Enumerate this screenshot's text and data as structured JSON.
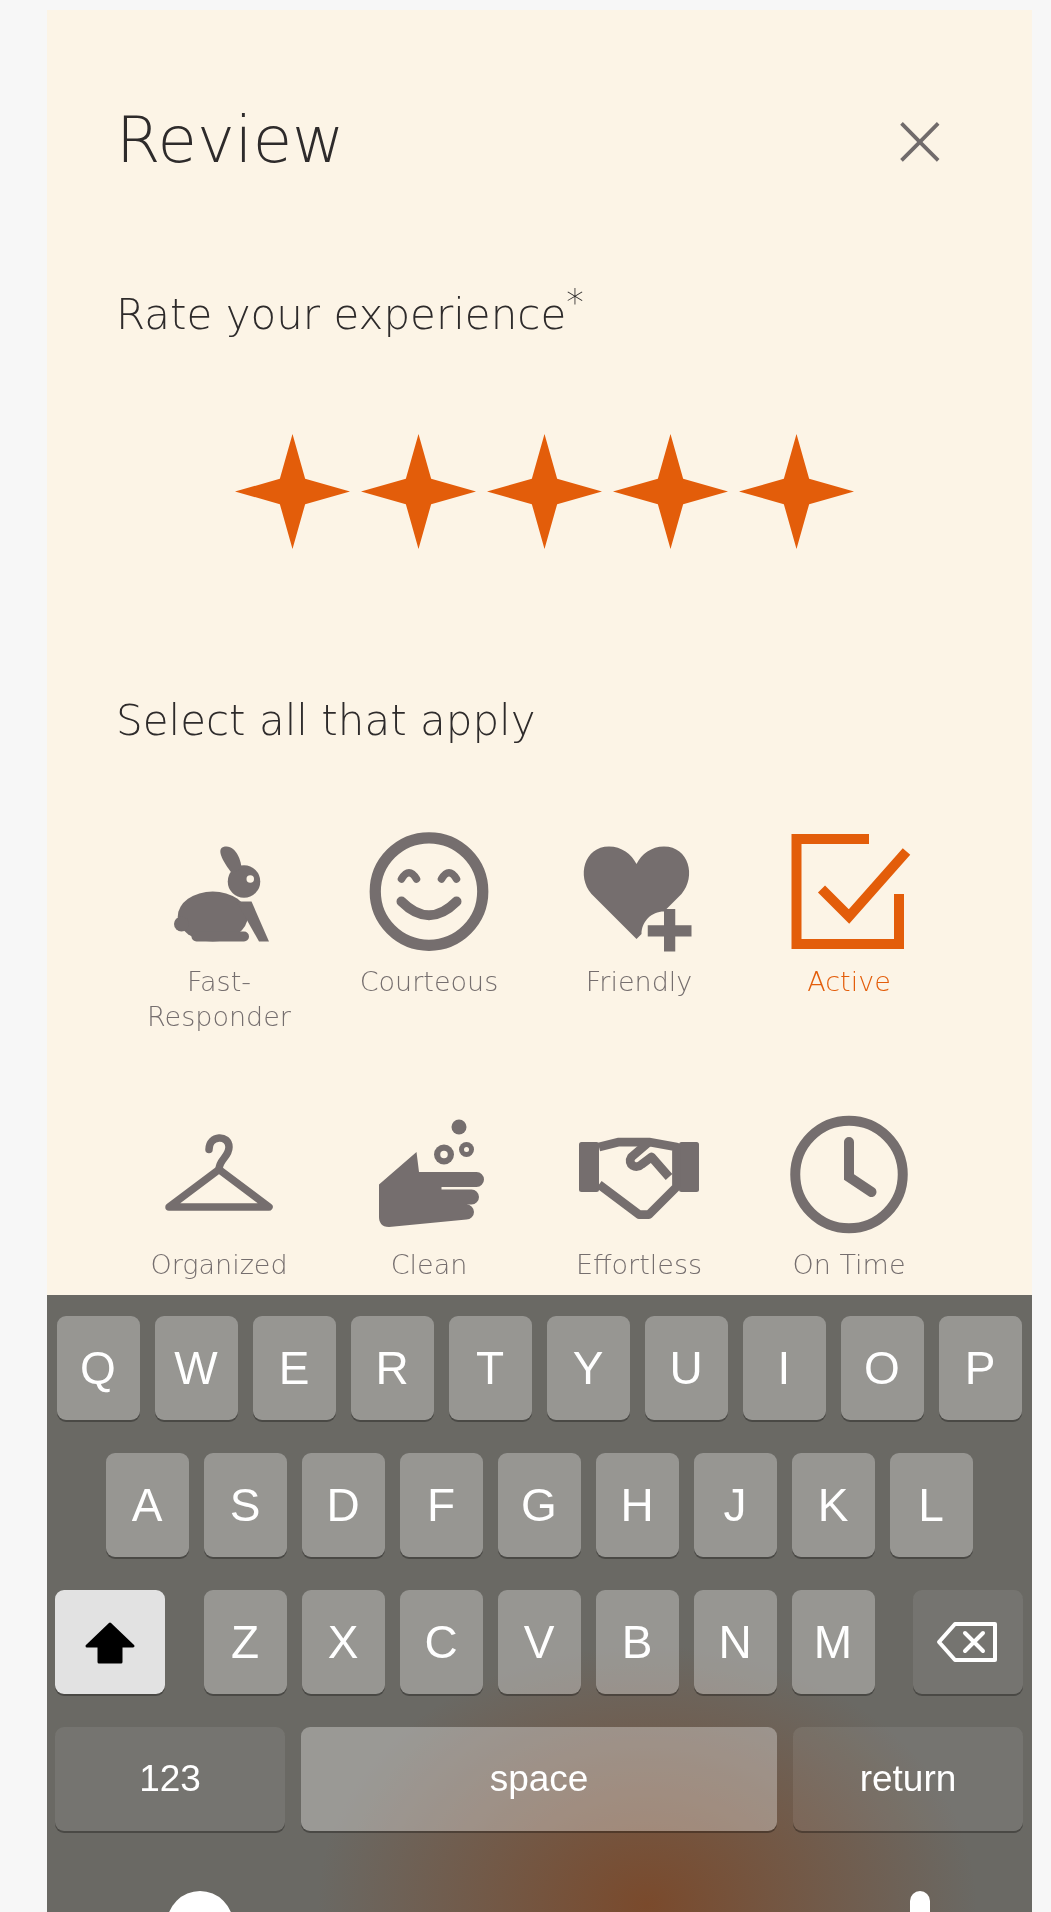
{
  "title": "Review",
  "close": {
    "label": "×"
  },
  "rating": {
    "prompt": "Rate your experience$^{*}$",
    "stars": 5
  },
  "tags_prompt": "Select all that apply",
  "tags": [
    {
      "label": "Fast-\nResponder",
      "kind": "rabbit",
      "selected": false
    },
    {
      "label": "Courteous",
      "kind": "smile",
      "selected": false
    },
    {
      "label": "Friendly",
      "kind": "heart",
      "selected": false
    },
    {
      "label": "Active",
      "kind": "check",
      "selected": true
    },
    {
      "label": "Organized",
      "kind": "hanger",
      "selected": false
    },
    {
      "label": "Clean",
      "kind": "hand",
      "selected": false
    },
    {
      "label": "Effortless",
      "kind": "handshake",
      "selected": false
    },
    {
      "label": "On Time",
      "kind": "clock",
      "selected": false
    }
  ],
  "keyboard": {
    "rows": [
      {
        "keys": [
          {
            "kind": "letter",
            "label": "Q"
          },
          {
            "kind": "letter",
            "label": "W"
          },
          {
            "kind": "letter",
            "label": "E"
          },
          {
            "kind": "letter",
            "label": "R"
          },
          {
            "kind": "letter",
            "label": "T"
          },
          {
            "kind": "letter",
            "label": "Y"
          },
          {
            "kind": "letter",
            "label": "U"
          },
          {
            "kind": "letter",
            "label": "I"
          },
          {
            "kind": "letter",
            "label": "O"
          },
          {
            "kind": "letter",
            "label": "P"
          }
        ]
      },
      {
        "keys": [
          {
            "kind": "letter",
            "label": "A"
          },
          {
            "kind": "letter",
            "label": "S"
          },
          {
            "kind": "letter",
            "label": "D"
          },
          {
            "kind": "letter",
            "label": "F"
          },
          {
            "kind": "letter",
            "label": "G"
          },
          {
            "kind": "letter",
            "label": "H"
          },
          {
            "kind": "letter",
            "label": "J"
          },
          {
            "kind": "letter",
            "label": "K"
          },
          {
            "kind": "letter",
            "label": "L"
          }
        ]
      },
      {
        "keys": [
          {
            "kind": "shift",
            "on": true
          },
          {
            "kind": "letter",
            "label": "Z"
          },
          {
            "kind": "letter",
            "label": "X"
          },
          {
            "kind": "letter",
            "label": "C"
          },
          {
            "kind": "letter",
            "label": "V"
          },
          {
            "kind": "letter",
            "label": "B"
          },
          {
            "kind": "letter",
            "label": "N"
          },
          {
            "kind": "letter",
            "label": "M"
          },
          {
            "kind": "backspace"
          }
        ]
      },
      {
        "keys": [
          {
            "kind": "numbers",
            "label": "123"
          },
          {
            "kind": "space",
            "label": "space"
          },
          {
            "kind": "return",
            "label": "return"
          }
        ]
      }
    ]
  }
}
